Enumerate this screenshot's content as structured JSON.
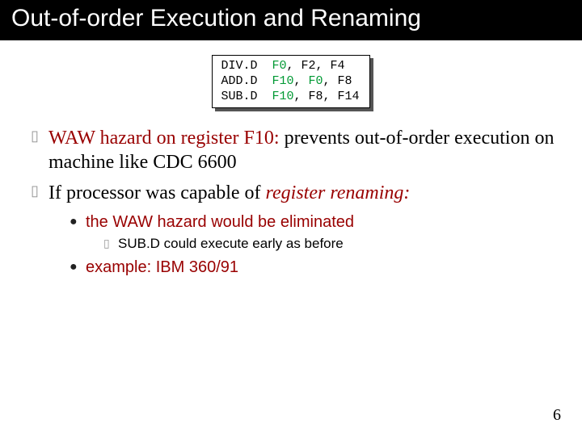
{
  "title": "Out-of-order Execution and Renaming",
  "code": {
    "lines": [
      {
        "op": "DIV.D",
        "dst": "F0",
        "src1": "F2",
        "src2": "F4",
        "dst_hl": true,
        "src1_hl": false
      },
      {
        "op": "ADD.D",
        "dst": "F10",
        "src1": "F0",
        "src2": "F8",
        "dst_hl": true,
        "src1_hl": true
      },
      {
        "op": "SUB.D",
        "dst": "F10",
        "src1": "F8",
        "src2": "F14",
        "dst_hl": true,
        "src1_hl": false
      }
    ]
  },
  "bullets": {
    "b1_lead": "WAW hazard on register F10:  ",
    "b1_rest": "prevents out-of-order execution on machine like CDC 6600",
    "b2_lead": "If processor was capable of ",
    "b2_em": "register renaming:",
    "sub1": "the WAW hazard would be eliminated",
    "subsub1": "SUB.D could execute early as before",
    "sub2": "example:  IBM 360/91"
  },
  "page_number": "6"
}
